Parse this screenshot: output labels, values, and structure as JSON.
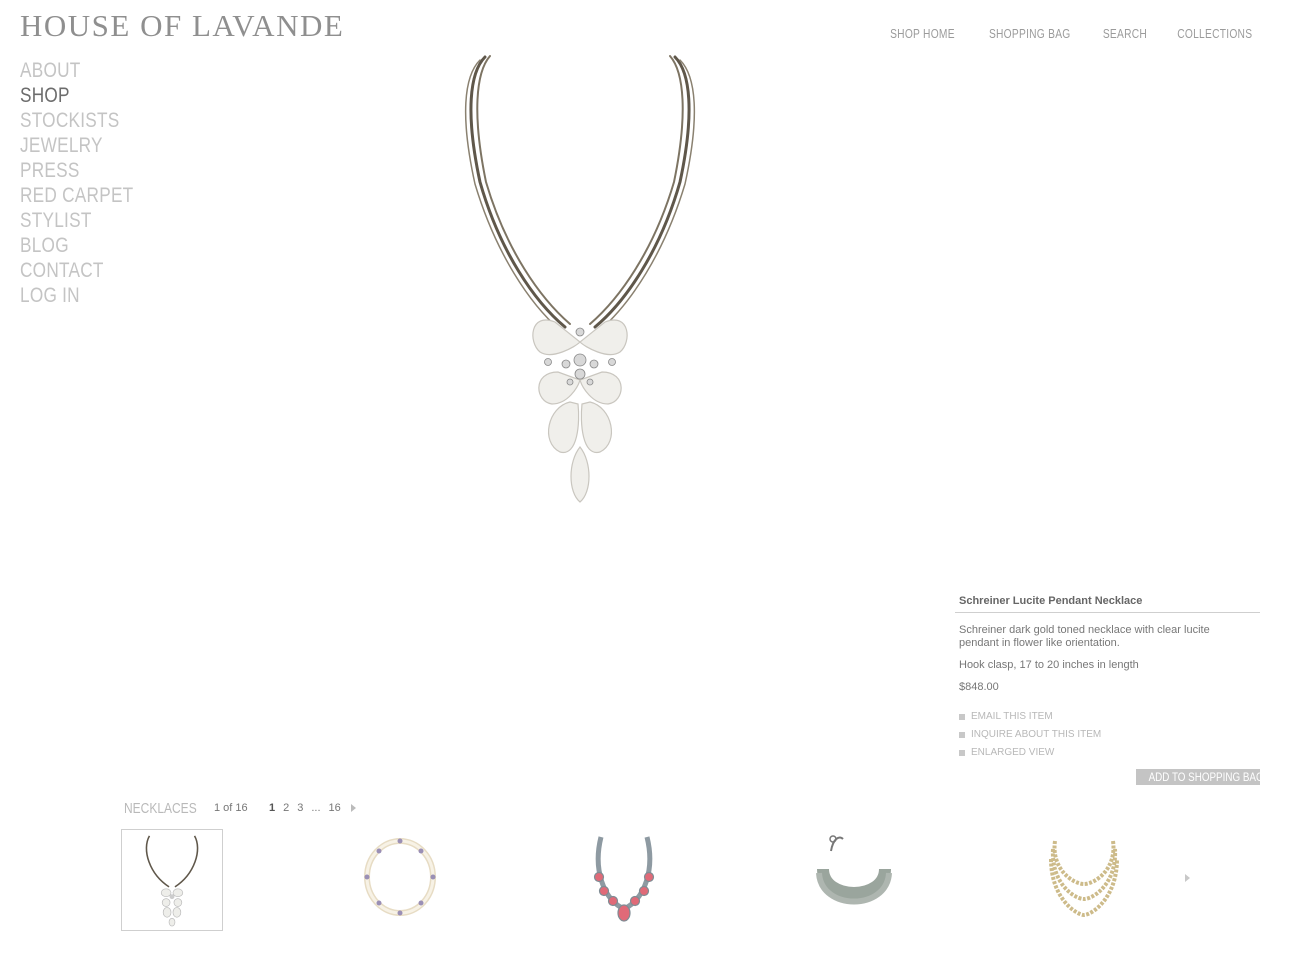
{
  "brand": {
    "logo_text": "HOUSE OF LAVANDE"
  },
  "top_nav": [
    "SHOP HOME",
    "SHOPPING BAG",
    "SEARCH",
    "COLLECTIONS"
  ],
  "side_nav": [
    {
      "label": "ABOUT",
      "active": false
    },
    {
      "label": "SHOP",
      "active": true
    },
    {
      "label": "STOCKISTS",
      "active": false
    },
    {
      "label": "JEWELRY",
      "active": false
    },
    {
      "label": "PRESS",
      "active": false
    },
    {
      "label": "RED CARPET",
      "active": false
    },
    {
      "label": "STYLIST",
      "active": false
    },
    {
      "label": "BLOG",
      "active": false
    },
    {
      "label": "CONTACT",
      "active": false
    },
    {
      "label": "LOG IN",
      "active": false
    }
  ],
  "product": {
    "title": "Schreiner Lucite Pendant Necklace",
    "description": "Schreiner dark gold toned necklace with clear lucite pendant in flower like orientation.",
    "spec": "Hook clasp, 17 to 20 inches in length",
    "price": "$848.00",
    "actions": [
      "EMAIL THIS ITEM",
      "INQUIRE ABOUT THIS ITEM",
      "ENLARGED VIEW"
    ],
    "add_to_bag": "ADD TO SHOPPING BAG"
  },
  "gallery": {
    "category": "NECKLACES",
    "count_text": "1 of 16",
    "pages": [
      "1",
      "2",
      "3",
      "...",
      "16"
    ],
    "current_page": "1",
    "thumbnails": [
      {
        "name": "thumb-lucite-pendant",
        "selected": true
      },
      {
        "name": "thumb-pearl-collar",
        "selected": false
      },
      {
        "name": "thumb-coral-bib",
        "selected": false
      },
      {
        "name": "thumb-crystal-choker",
        "selected": false
      },
      {
        "name": "thumb-gold-leaf-layered",
        "selected": false
      }
    ]
  },
  "colors": {
    "nav_inactive": "#c4c4c4",
    "nav_active": "#6c6c6c",
    "button_bg": "#c4c4c4"
  }
}
